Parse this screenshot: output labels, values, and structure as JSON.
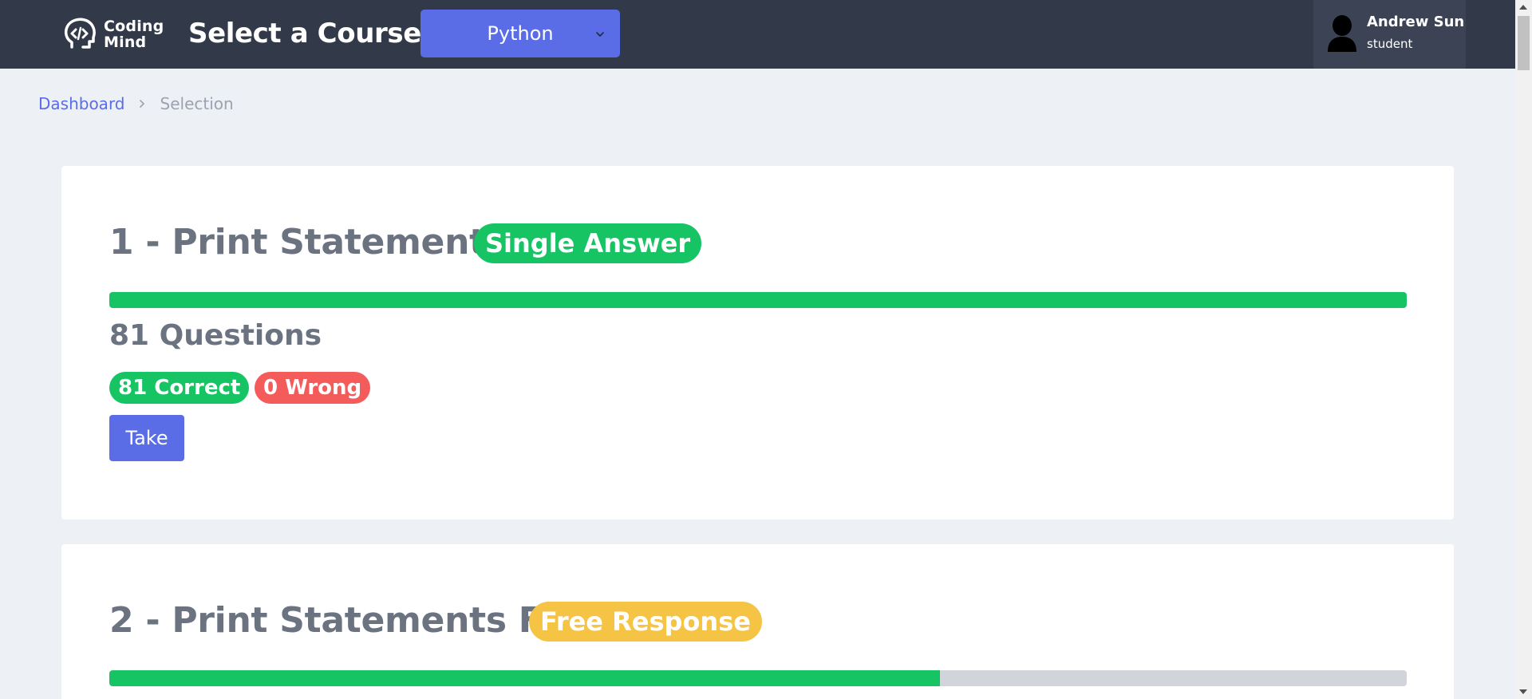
{
  "header": {
    "logo_line1": "Coding",
    "logo_line2": "Mind",
    "course_label": "Select a Course:",
    "course_selected": "Python",
    "user_name": "Andrew Sun",
    "user_role": "student"
  },
  "breadcrumb": {
    "home": "Dashboard",
    "current": "Selection"
  },
  "colors": {
    "accent": "#5a6de6",
    "success": "#16c464",
    "danger": "#f45b5b",
    "warning": "#f5c445",
    "topbar": "#323a4a"
  },
  "cards": [
    {
      "title": "1 - Print Statements",
      "type_label": "Single Answer",
      "type_color": "#16c464",
      "progress_fraction": 1.0,
      "question_count": "81 Questions",
      "correct_label": "81 Correct",
      "wrong_label": "0 Wrong",
      "take_label": "Take"
    },
    {
      "title": "2 - Print Statements FR",
      "type_label": "Free Response",
      "type_color": "#f5c445",
      "progress_fraction": 0.64
    }
  ]
}
